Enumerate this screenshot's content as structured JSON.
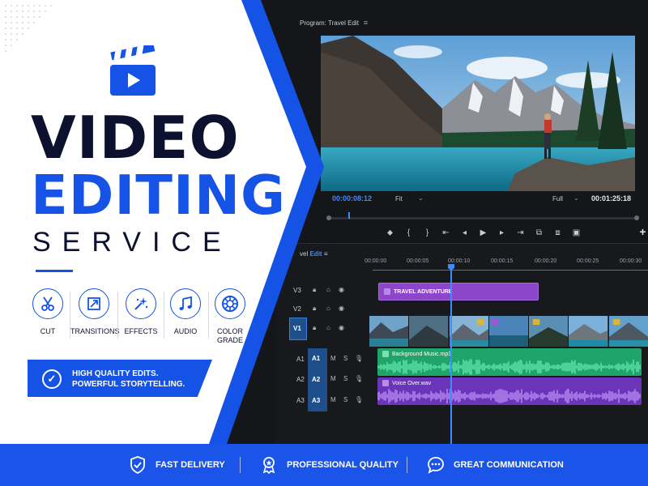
{
  "colors": {
    "brand_blue": "#1553e6",
    "navy": "#0d1130",
    "title_clip": "#8d45c9",
    "music_clip": "#1fa46a",
    "voice_clip": "#6a35b8",
    "playhead": "#3b8cff"
  },
  "headline": {
    "line1": "VIDEO",
    "line2": "EDITING",
    "line3": "SERVICE"
  },
  "logo": {
    "icon": "clapperboard-play-icon"
  },
  "features": [
    {
      "icon": "scissors-icon",
      "label": "CUT"
    },
    {
      "icon": "transitions-icon",
      "label": "TRANSITIONS"
    },
    {
      "icon": "sparkles-icon",
      "label": "EFFECTS"
    },
    {
      "icon": "music-note-icon",
      "label": "AUDIO"
    },
    {
      "icon": "color-wheel-icon",
      "label": "COLOR GRADE"
    }
  ],
  "banner": {
    "icon": "check-circle-icon",
    "line1": "HIGH QUALITY EDITS.",
    "line2": "POWERFUL STORYTELLING."
  },
  "editor": {
    "program_title": "Program: Travel Edit",
    "menu_glyph": "≡",
    "current_timecode": "00:00:08:12",
    "fit": "Fit",
    "quality": "Full",
    "duration": "00:01:25:18",
    "sequence_prefix": "vel",
    "sequence_name": "Edit",
    "ruler": [
      "00:00:00",
      "00:00:05",
      "00:00:10",
      "00:00:15",
      "00:00:20",
      "00:00:25",
      "00:00:30"
    ],
    "video_tracks": [
      "V3",
      "V2",
      "V1"
    ],
    "audio_tracks": [
      {
        "name": "A1",
        "label": "A1"
      },
      {
        "name": "A2",
        "label": "A2"
      },
      {
        "name": "A3",
        "label": "A3"
      }
    ],
    "track_m": "M",
    "track_s": "S",
    "title_clip": "TRAVEL ADVENTURE",
    "music_clip": "Background Music.mp3",
    "voice_clip": "Voice Over.wav",
    "add_button": "+"
  },
  "footer": [
    {
      "icon": "shield-check-icon",
      "label": "FAST DELIVERY"
    },
    {
      "icon": "award-badge-icon",
      "label": "PROFESSIONAL QUALITY"
    },
    {
      "icon": "chat-bubble-icon",
      "label": "GREAT COMMUNICATION"
    }
  ]
}
